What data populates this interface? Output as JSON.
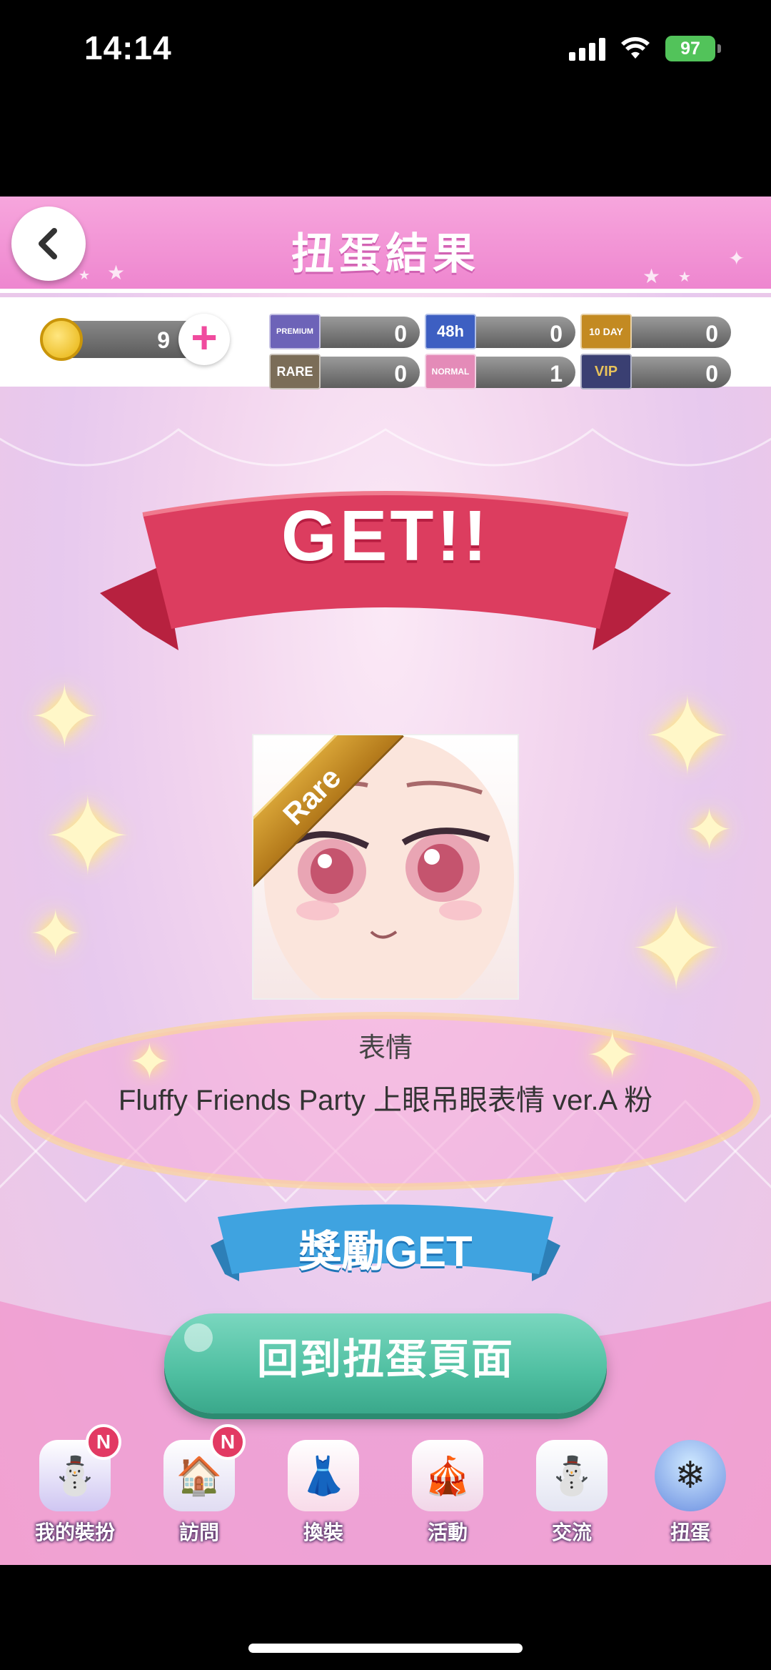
{
  "status_bar": {
    "time": "14:14",
    "battery": "97"
  },
  "header": {
    "title": "扭蛋結果",
    "back_icon": "chevron-left-icon"
  },
  "currency": {
    "coins": "9",
    "tickets": [
      {
        "label": "PREMIUM",
        "value": "0",
        "color": "#6d63b8"
      },
      {
        "label": "48h",
        "value": "0",
        "color": "#3d5fc2"
      },
      {
        "label": "10 DAY",
        "value": "0",
        "color": "#c38a22"
      },
      {
        "label": "RARE",
        "value": "0",
        "color": "#7b6d58"
      },
      {
        "label": "NORMAL",
        "value": "1",
        "color": "#e48bb8"
      },
      {
        "label": "VIP",
        "value": "0",
        "color": "#3a3f72"
      }
    ]
  },
  "result": {
    "banner_text": "GET!!",
    "rarity": "Rare",
    "category": "表情",
    "item_name": "Fluffy Friends Party 上眼吊眼表情 ver.A 粉"
  },
  "reward": {
    "banner_text": "獎勵GET",
    "return_button": "回到扭蛋頁面"
  },
  "nav": {
    "items": [
      {
        "label": "我的裝扮",
        "icon": "snowman-cake-icon",
        "badge": "N"
      },
      {
        "label": "訪問",
        "icon": "visit-icon",
        "badge": "N"
      },
      {
        "label": "換裝",
        "icon": "dress-icon"
      },
      {
        "label": "活動",
        "icon": "tent-icon"
      },
      {
        "label": "交流",
        "icon": "friends-icon"
      },
      {
        "label": "扭蛋",
        "icon": "gacha-machine-icon"
      }
    ]
  },
  "colors": {
    "accent_pink": "#ee86cf",
    "banner_red": "#dc3d5f",
    "button_green": "#4fbfa1",
    "reward_blue": "#3fa3e0"
  }
}
